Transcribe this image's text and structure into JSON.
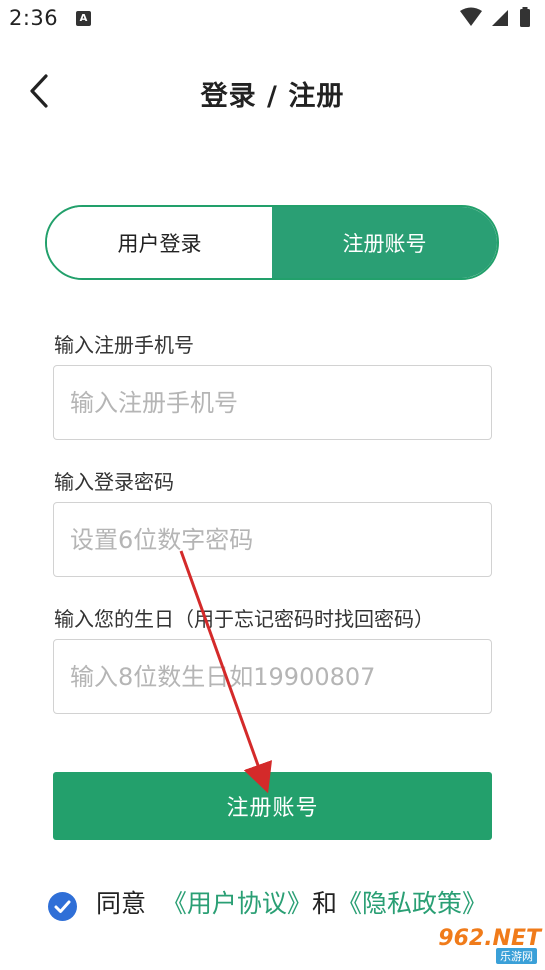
{
  "status_bar": {
    "time": "2:36",
    "notification_badge": "A",
    "icons": [
      "wifi-icon",
      "signal-icon",
      "battery-icon"
    ]
  },
  "header": {
    "back_icon": "chevron-left-icon",
    "title": "登录 / 注册"
  },
  "tabs": [
    {
      "label": "用户登录",
      "active": false
    },
    {
      "label": "注册账号",
      "active": true
    }
  ],
  "form": {
    "phone": {
      "label": "输入注册手机号",
      "placeholder": "输入注册手机号",
      "value": ""
    },
    "password": {
      "label": "输入登录密码",
      "placeholder": "设置6位数字密码",
      "value": ""
    },
    "birthday": {
      "label": "输入您的生日（用于忘记密码时找回密码）",
      "placeholder": "输入8位数生日如19900807",
      "value": ""
    }
  },
  "submit_label": "注册账号",
  "agreement": {
    "checked": true,
    "prefix": "同意",
    "user_agreement": "《用户协议》",
    "conjunction": "和",
    "privacy_policy": "《隐私政策》"
  },
  "watermark": {
    "text": "962.NET",
    "sub": "乐游网"
  },
  "colors": {
    "accent": "#2a9f74",
    "button": "#23a06c",
    "checkbox": "#2f6fd7",
    "annotation_arrow": "#d42a2a"
  }
}
